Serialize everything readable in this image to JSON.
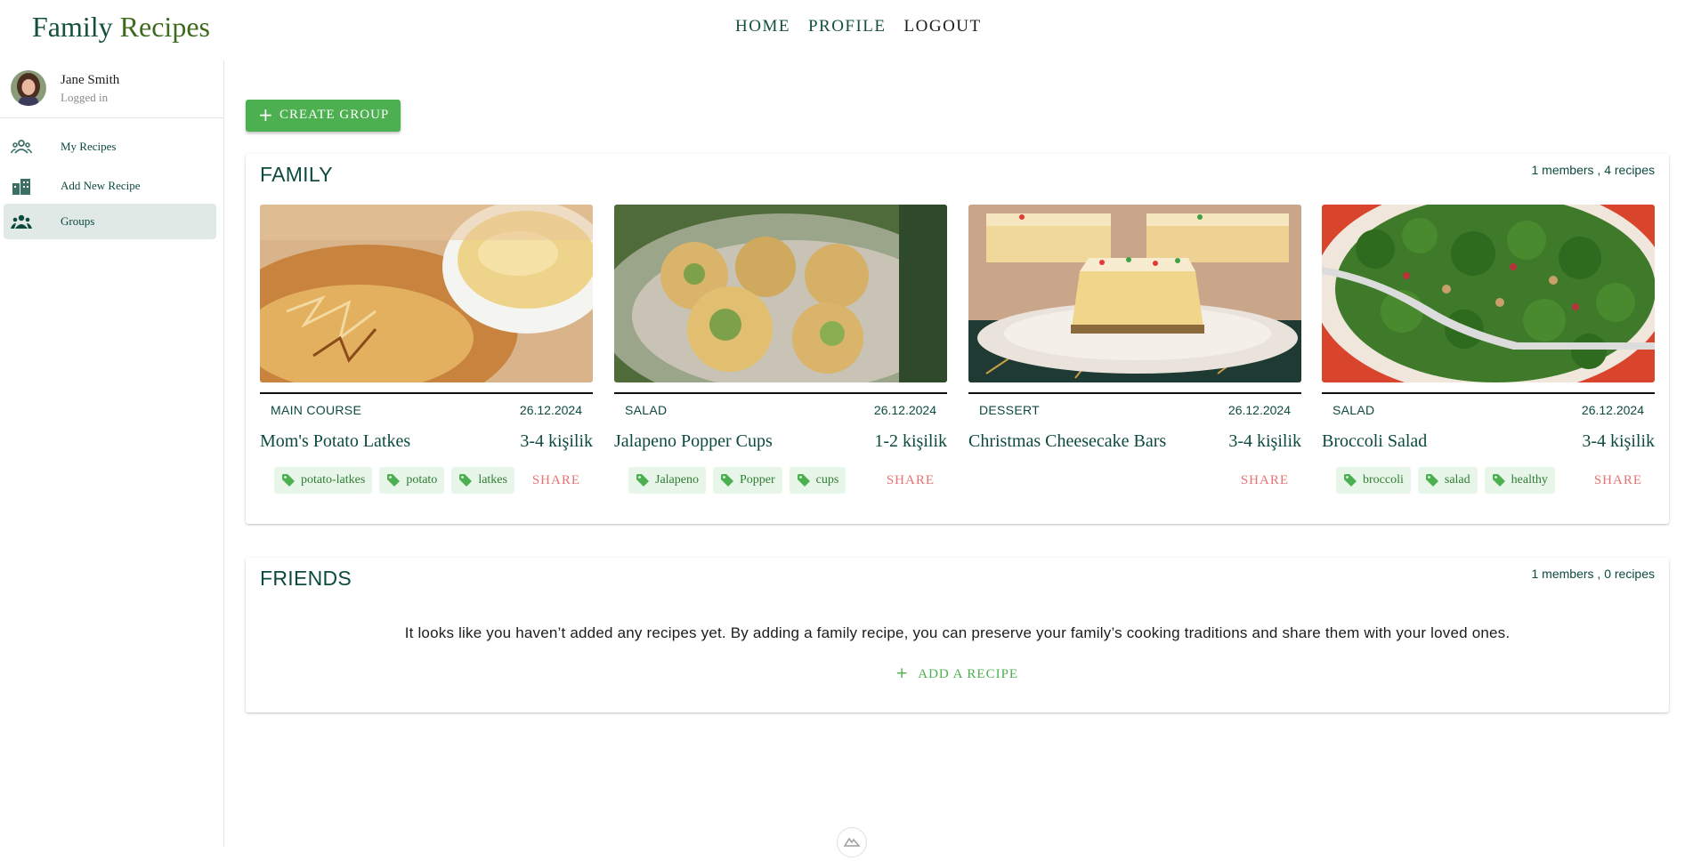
{
  "app": {
    "logo_part1": "Family",
    "logo_part2": "Recipes"
  },
  "topnav": {
    "home": "HOME",
    "profile": "PROFILE",
    "logout": "LOGOUT"
  },
  "user": {
    "name": "Jane Smith",
    "status": "Logged in"
  },
  "sidebar": {
    "items": [
      {
        "label": "My Recipes",
        "icon": "people-icon",
        "active": false
      },
      {
        "label": "Add New Recipe",
        "icon": "building-icon",
        "active": false
      },
      {
        "label": "Groups",
        "icon": "groups-icon",
        "active": true
      }
    ]
  },
  "create_group": {
    "label": "CREATE GROUP"
  },
  "groups": [
    {
      "title": "FAMILY",
      "meta": "1 members , 4 recipes",
      "recipes": [
        {
          "category": "MAIN COURSE",
          "date": "26.12.2024",
          "title": "Mom's Potato Latkes",
          "servings": "3-4 kişilik",
          "tags": [
            "potato-latkes",
            "potato",
            "latkes"
          ],
          "share": "SHARE"
        },
        {
          "category": "SALAD",
          "date": "26.12.2024",
          "title": "Jalapeno Popper Cups",
          "servings": "1-2 kişilik",
          "tags": [
            "Jalapeno",
            "Popper",
            "cups"
          ],
          "share": "SHARE"
        },
        {
          "category": "DESSERT",
          "date": "26.12.2024",
          "title": "Christmas Cheesecake Bars",
          "servings": "3-4 kişilik",
          "tags": [],
          "share": "SHARE"
        },
        {
          "category": "SALAD",
          "date": "26.12.2024",
          "title": "Broccoli Salad",
          "servings": "3-4 kişilik",
          "tags": [
            "broccoli",
            "salad",
            "healthy"
          ],
          "share": "SHARE"
        }
      ]
    },
    {
      "title": "FRIENDS",
      "meta": "1 members , 0 recipes",
      "empty_message": "It looks like you haven’t added any recipes yet. By adding a family recipe, you can preserve your family’s cooking traditions and share them with your loved ones.",
      "add_recipe": "ADD A RECIPE"
    }
  ],
  "colors": {
    "primary_dark": "#0d4a3e",
    "accent_green": "#4caf50",
    "share_red": "#e57373",
    "active_nav_bg": "#e1e9e7"
  }
}
